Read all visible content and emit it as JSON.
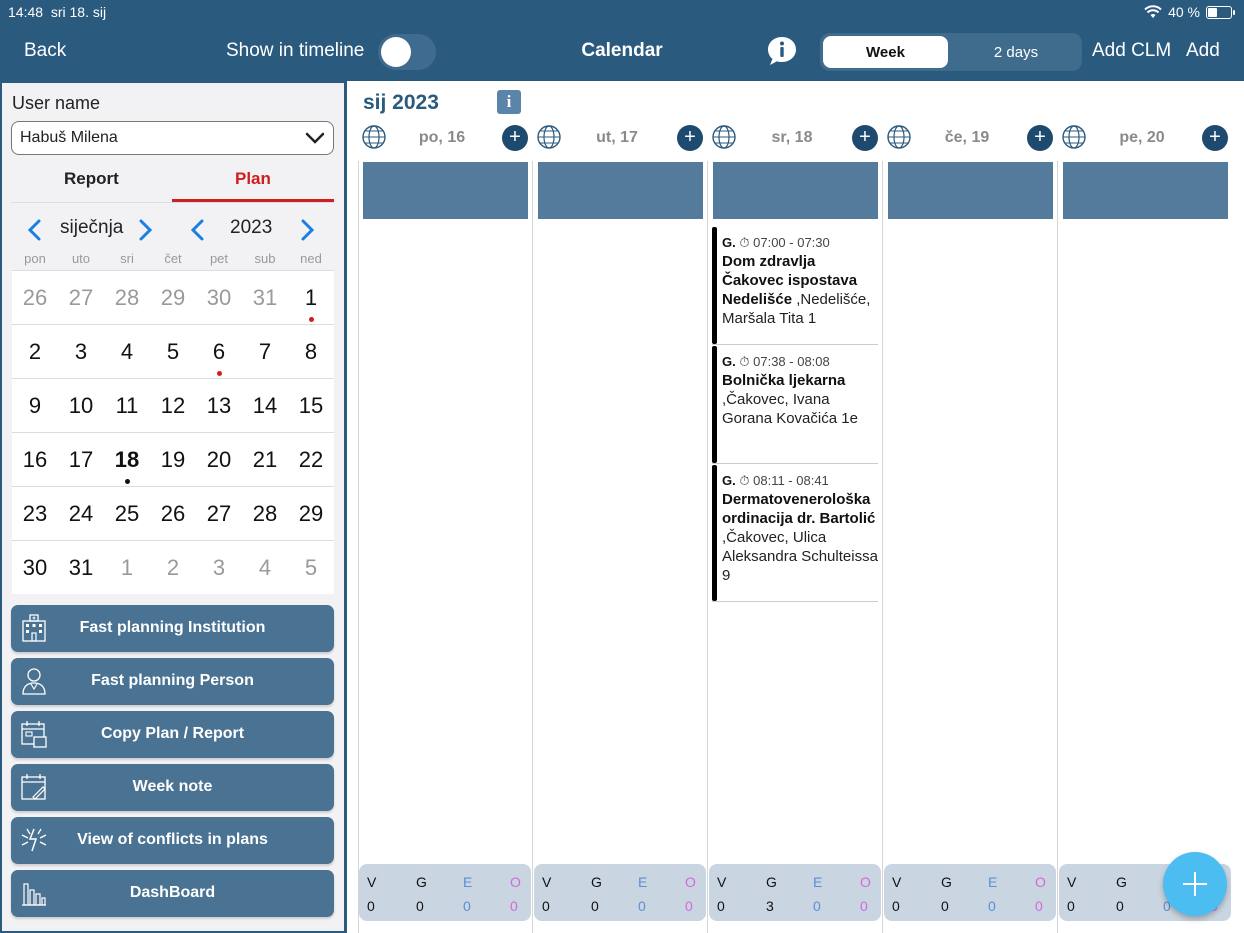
{
  "statusbar": {
    "time": "14:48",
    "date": "sri 18. sij",
    "battery_text": "40 %",
    "battery_level": 0.4
  },
  "navbar": {
    "back": "Back",
    "show_in_timeline": "Show in timeline",
    "title": "Calendar",
    "segments": {
      "week": "Week",
      "two_days": "2 days",
      "selected": "Week"
    },
    "add_clm": "Add CLM",
    "add": "Add"
  },
  "left": {
    "user_label": "User name",
    "user_value": "Habuš Milena",
    "tabs": {
      "report": "Report",
      "plan": "Plan",
      "active": "Plan"
    },
    "mini_calendar": {
      "month": "siječnja",
      "year": "2023",
      "weekdays": [
        "pon",
        "uto",
        "sri",
        "čet",
        "pet",
        "sub",
        "ned"
      ],
      "weeks": [
        [
          "26",
          "27",
          "28",
          "29",
          "30",
          "31",
          "1"
        ],
        [
          "2",
          "3",
          "4",
          "5",
          "6",
          "7",
          "8"
        ],
        [
          "9",
          "10",
          "11",
          "12",
          "13",
          "14",
          "15"
        ],
        [
          "16",
          "17",
          "18",
          "19",
          "20",
          "21",
          "22"
        ],
        [
          "23",
          "24",
          "25",
          "26",
          "27",
          "28",
          "29"
        ],
        [
          "30",
          "31",
          "1",
          "2",
          "3",
          "4",
          "5"
        ]
      ]
    },
    "buttons": [
      {
        "label": "Fast planning Institution",
        "icon": "institution-icon"
      },
      {
        "label": "Fast planning Person",
        "icon": "person-icon"
      },
      {
        "label": "Copy Plan / Report",
        "icon": "copy-calendar-icon"
      },
      {
        "label": "Week note",
        "icon": "note-calendar-icon"
      },
      {
        "label": "View of conflicts in plans",
        "icon": "conflict-icon"
      },
      {
        "label": "DashBoard",
        "icon": "chart-icon"
      }
    ]
  },
  "calendar": {
    "month_title": "sij 2023",
    "days": [
      "po, 16",
      "ut, 17",
      "sr, 18",
      "če, 19",
      "pe, 20"
    ],
    "events": [
      {
        "type": "G.",
        "time": "07:00 - 07:30",
        "name": "Dom zdravlja Čakovec ispostava Nedelišće",
        "address": " ,Nedelišće, Maršala Tita 1"
      },
      {
        "type": "G.",
        "time": "07:38 - 08:08",
        "name": "Bolnička ljekarna",
        "address": " ,Čakovec, Ivana Gorana Kovačića 1e"
      },
      {
        "type": "G.",
        "time": "08:11 - 08:41",
        "name": "Dermatovenerološka ordinacija dr. Bartolić",
        "address": " ,Čakovec, Ulica Aleksandra Schulteissa 9"
      }
    ],
    "stats": {
      "labels": [
        "V",
        "G",
        "E",
        "O"
      ],
      "values": [
        [
          "0",
          "0",
          "0",
          "0"
        ],
        [
          "0",
          "0",
          "0",
          "0"
        ],
        [
          "0",
          "3",
          "0",
          "0"
        ],
        [
          "0",
          "0",
          "0",
          "0"
        ],
        [
          "0",
          "0",
          "0",
          "0"
        ]
      ]
    }
  },
  "colors": {
    "navbar": "#2b5a7f",
    "plan_tab": "#d01e1e",
    "button": "#4a7292",
    "fab": "#4cbdf1",
    "e_label": "#5b8fd6",
    "o_label": "#d16ad9",
    "event_dot": "#d01e1e"
  }
}
